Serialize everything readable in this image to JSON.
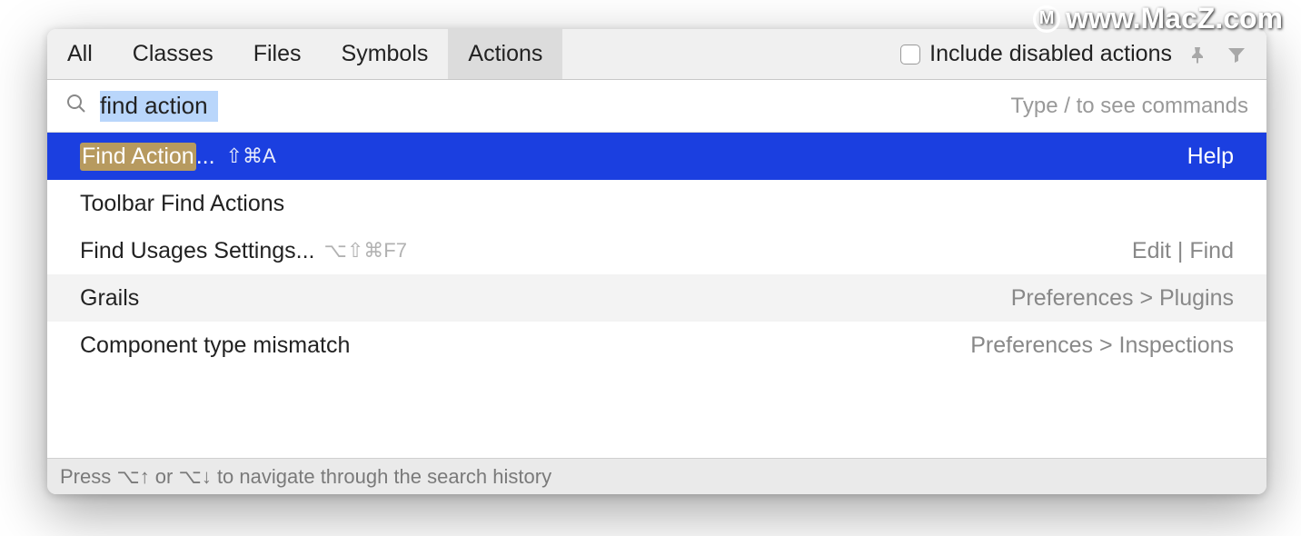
{
  "watermark": "www.MacZ.com",
  "tabs": {
    "all": "All",
    "classes": "Classes",
    "files": "Files",
    "symbols": "Symbols",
    "actions": "Actions"
  },
  "checkbox_label": "Include disabled actions",
  "search": {
    "value": "find action",
    "hint": "Type / to see commands"
  },
  "results": [
    {
      "highlight": "Find Action",
      "suffix": "...",
      "shortcut": "⇧⌘A",
      "context": "Help",
      "selected": true
    },
    {
      "label": "Toolbar Find Actions",
      "context": ""
    },
    {
      "label": "Find Usages Settings...",
      "shortcut": "⌥⇧⌘F7",
      "context": "Edit | Find"
    },
    {
      "label": "Grails",
      "context": "Preferences > Plugins",
      "alt": true
    },
    {
      "label": "Component type mismatch",
      "context": "Preferences > Inspections"
    }
  ],
  "footer": "Press ⌥↑ or ⌥↓ to navigate through the search history"
}
